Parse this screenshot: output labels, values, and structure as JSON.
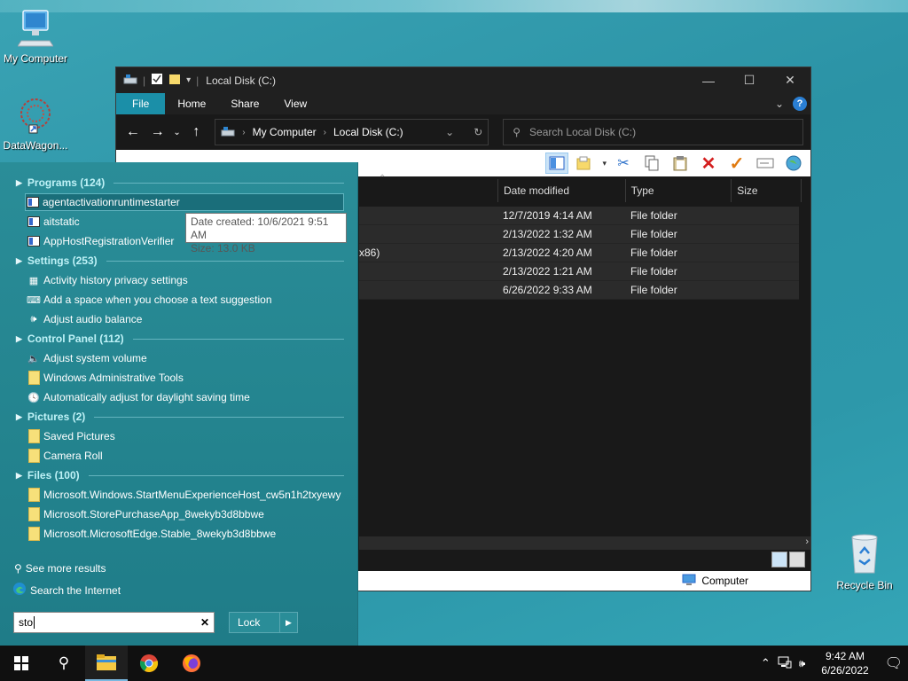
{
  "desktop": {
    "icons": [
      {
        "label": "My Computer"
      },
      {
        "label": "DataWagon..."
      },
      {
        "label": "Recycle Bin"
      }
    ]
  },
  "explorer": {
    "title": "Local Disk (C:)",
    "tabs": {
      "file": "File",
      "home": "Home",
      "share": "Share",
      "view": "View"
    },
    "address": {
      "crumb1": "My Computer",
      "crumb2": "Local Disk (C:)"
    },
    "search_placeholder": "Search Local Disk (C:)",
    "columns": {
      "date": "Date modified",
      "type": "Type",
      "size": "Size"
    },
    "rows": [
      {
        "name_fragment": "",
        "date": "12/7/2019 4:14 AM",
        "type": "File folder"
      },
      {
        "name_fragment": "",
        "date": "2/13/2022 1:32 AM",
        "type": "File folder"
      },
      {
        "name_fragment": "x86)",
        "date": "2/13/2022 4:20 AM",
        "type": "File folder"
      },
      {
        "name_fragment": "",
        "date": "2/13/2022 1:21 AM",
        "type": "File folder"
      },
      {
        "name_fragment": "",
        "date": "6/26/2022 9:33 AM",
        "type": "File folder"
      }
    ],
    "status_location": "Computer"
  },
  "startmenu": {
    "sections": {
      "programs": "Programs (124)",
      "settings": "Settings (253)",
      "control_panel": "Control Panel (112)",
      "pictures": "Pictures (2)",
      "files": "Files (100)"
    },
    "programs": [
      "agentactivationruntimestarter",
      "aitstatic",
      "AppHostRegistrationVerifier"
    ],
    "settings": [
      "Activity history privacy settings",
      "Add a space when you choose a text suggestion",
      "Adjust audio balance"
    ],
    "control_panel": [
      "Adjust system volume",
      "Windows Administrative Tools",
      "Automatically adjust for daylight saving time"
    ],
    "pictures": [
      "Saved Pictures",
      "Camera Roll"
    ],
    "files": [
      "Microsoft.Windows.StartMenuExperienceHost_cw5n1h2txyewy",
      "Microsoft.StorePurchaseApp_8wekyb3d8bbwe",
      "Microsoft.MicrosoftEdge.Stable_8wekyb3d8bbwe"
    ],
    "tooltip": {
      "line1": "Date created: 10/6/2021 9:51 AM",
      "line2": "Size: 13.0 KB"
    },
    "see_more": "See more results",
    "search_internet": "Search the Internet",
    "search_value": "sto",
    "lock_label": "Lock"
  },
  "taskbar": {
    "time": "9:42 AM",
    "date": "6/26/2022"
  },
  "colors": {
    "accent": "#1b8fa8",
    "startmenu_bg": "#2a8d98",
    "section_text": "#bff2f7"
  }
}
